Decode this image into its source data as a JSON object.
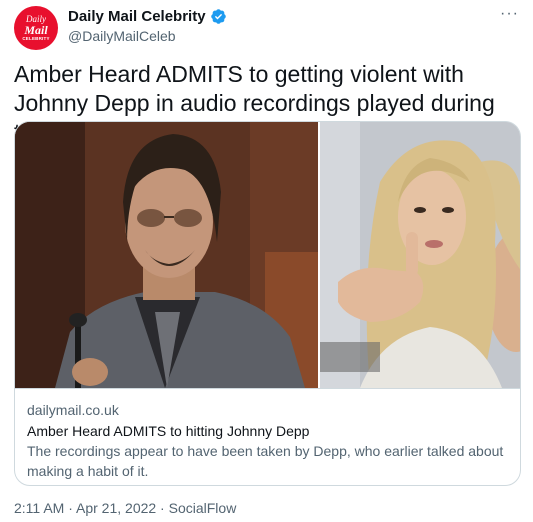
{
  "account": {
    "display_name": "Daily Mail Celebrity",
    "handle": "@DailyMailCeleb",
    "avatar_text": {
      "line1": "Daily",
      "line2": "Mail",
      "line3": "CELEBRITY"
    },
    "verified_icon": "verified-badge-icon"
  },
  "menu": {
    "more_label": "···"
  },
  "tweet": {
    "text": "Amber Heard ADMITS to getting violent with Johnny Depp in audio recordings played during trial"
  },
  "card": {
    "domain": "dailymail.co.uk",
    "title": "Amber Heard ADMITS to hitting Johnny Depp",
    "description": "The recordings appear to have been taken by Depp, who earlier talked about making a habit of it."
  },
  "meta": {
    "time": "2:11 AM",
    "separator": " · ",
    "date": "Apr 21, 2022",
    "source": "SocialFlow"
  },
  "colors": {
    "brand_red": "#e8102e",
    "verified_blue": "#1d9bf0",
    "secondary_text": "#536471",
    "border": "#cfd9de"
  }
}
